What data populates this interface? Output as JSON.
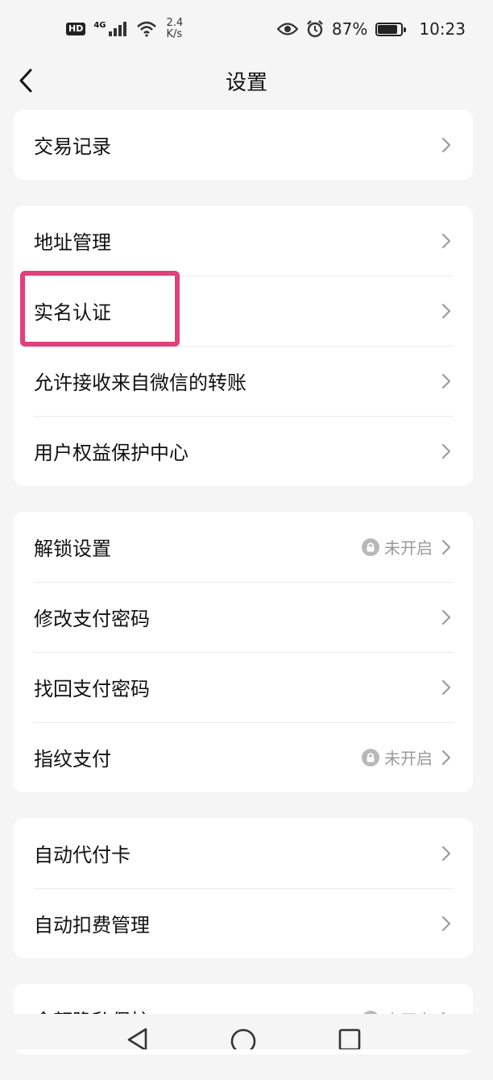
{
  "status_bar": {
    "hd": "HD",
    "network": "4G",
    "speed_value": "2.4",
    "speed_unit": "K/s",
    "battery": "87%",
    "battery_level": 0.87,
    "time": "10:23",
    "icons": [
      "hd-icon",
      "signal-icon",
      "wifi-icon",
      "eye-icon",
      "alarm-icon",
      "battery-icon"
    ]
  },
  "header": {
    "title": "设置"
  },
  "groups": [
    {
      "items": [
        {
          "label": "交易记录"
        }
      ]
    },
    {
      "items": [
        {
          "label": "地址管理"
        },
        {
          "label": "实名认证"
        },
        {
          "label": "允许接收来自微信的转账"
        },
        {
          "label": "用户权益保护中心"
        }
      ]
    },
    {
      "items": [
        {
          "label": "解锁设置",
          "status": "未开启"
        },
        {
          "label": "修改支付密码"
        },
        {
          "label": "找回支付密码"
        },
        {
          "label": "指纹支付",
          "status": "未开启"
        }
      ]
    },
    {
      "items": [
        {
          "label": "自动代付卡"
        },
        {
          "label": "自动扣费管理"
        }
      ]
    },
    {
      "items": [
        {
          "label": "余额隐私保护",
          "status": "未开启"
        }
      ]
    }
  ],
  "colors": {
    "background": "#f5f5f5",
    "card": "#ffffff",
    "highlight": "#e0407b",
    "muted": "#9a9a9a"
  }
}
